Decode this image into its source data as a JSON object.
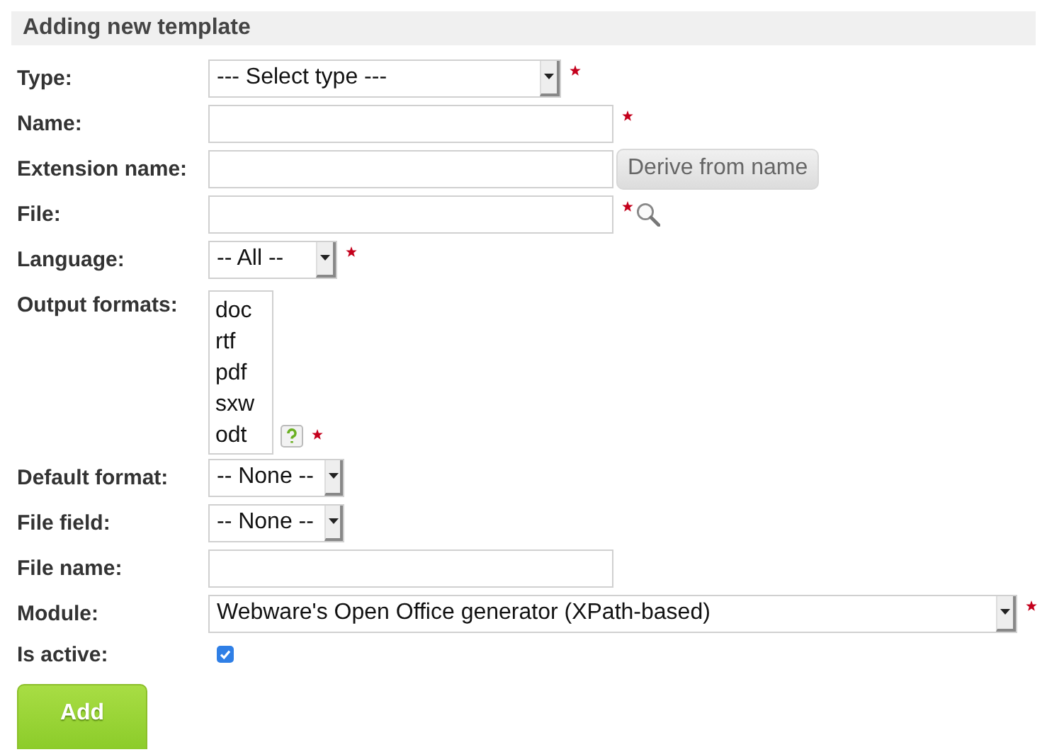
{
  "title": "Adding new template",
  "fields": [
    {
      "kind": "select",
      "label": "Type:",
      "value": "--- Select type ---",
      "required": true
    },
    {
      "kind": "text",
      "label": "Name:",
      "required": true
    },
    {
      "kind": "text-button",
      "label": "Extension name:",
      "required": false,
      "button": "Derive from name"
    },
    {
      "kind": "file",
      "label": "File:",
      "required": true
    },
    {
      "kind": "select",
      "label": "Language:",
      "value": "-- All --",
      "required": true
    },
    {
      "kind": "listbox",
      "label": "Output formats:",
      "required": true,
      "options": [
        {
          "label": "doc",
          "selected": false
        },
        {
          "label": "rtf",
          "selected": false
        },
        {
          "label": "pdf",
          "selected": false
        },
        {
          "label": "sxw",
          "selected": false
        },
        {
          "label": "odt",
          "selected": false
        }
      ]
    },
    {
      "kind": "select",
      "label": "Default format:",
      "value": "-- None --",
      "required": false
    },
    {
      "kind": "select",
      "label": "File field:",
      "value": "-- None --",
      "required": false
    },
    {
      "kind": "text",
      "label": "File name:",
      "required": false
    },
    {
      "kind": "select",
      "label": "Module:",
      "value": "Webware's Open Office generator (XPath-based)",
      "required": true
    },
    {
      "kind": "checkbox",
      "label": "Is active:",
      "checked": true
    }
  ],
  "submit": "Add"
}
